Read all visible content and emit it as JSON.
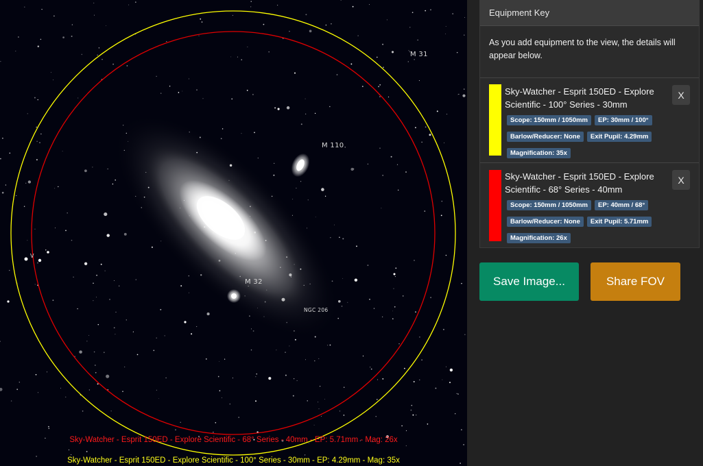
{
  "sky": {
    "labels": {
      "m31": "M 31",
      "m110": "M 110",
      "m32": "M 32",
      "ngc206": "NGC 206",
      "v": "V"
    },
    "captions": {
      "red": "Sky-Watcher - Esprit 150ED - Explore Scientific - 68° Series - 40mm - EP: 5.71mm - Mag: 26x",
      "yellow": "Sky-Watcher - Esprit 150ED - Explore Scientific - 100° Series - 30mm - EP: 4.29mm - Mag: 35x"
    }
  },
  "equipment_key": {
    "title": "Equipment Key",
    "intro": "As you add equipment to the view, the details will appear below.",
    "items": [
      {
        "color": "#ffff00",
        "title": "Sky-Watcher - Esprit 150ED - Explore Scientific - 100° Series - 30mm",
        "tags": [
          "Scope: 150mm / 1050mm",
          "EP: 30mm / 100°",
          "Barlow/Reducer: None",
          "Exit Pupil: 4.29mm",
          "Magnification: 35x"
        ],
        "remove_label": "X"
      },
      {
        "color": "#ff0000",
        "title": "Sky-Watcher - Esprit 150ED - Explore Scientific - 68° Series - 40mm",
        "tags": [
          "Scope: 150mm / 1050mm",
          "EP: 40mm / 68°",
          "Barlow/Reducer: None",
          "Exit Pupil: 5.71mm",
          "Magnification: 26x"
        ],
        "remove_label": "X"
      }
    ]
  },
  "actions": {
    "save_label": "Save Image...",
    "share_label": "Share FOV"
  },
  "colors": {
    "yellow_fov": "#ffff00",
    "red_fov": "#ff0000",
    "save_button": "#078a63",
    "share_button": "#c57f0f",
    "tag_bg": "#3c5a7a"
  }
}
